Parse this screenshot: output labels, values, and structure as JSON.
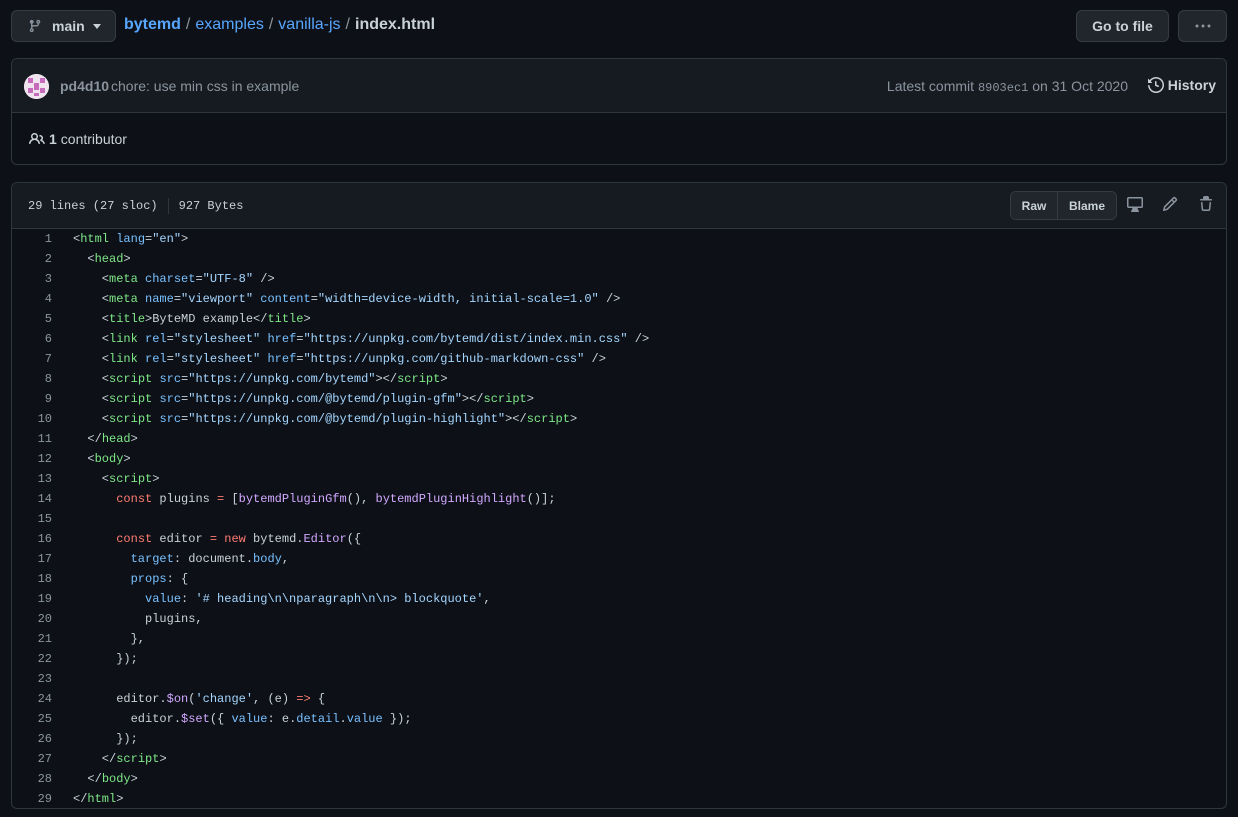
{
  "branch": {
    "name": "main"
  },
  "breadcrumb": {
    "repo": "bytemd",
    "dir1": "examples",
    "dir2": "vanilla-js",
    "file": "index.html",
    "sep": "/"
  },
  "actions": {
    "goto_file": "Go to file"
  },
  "commit": {
    "author": "pd4d10",
    "message": "chore: use min css in example",
    "latest_label": "Latest commit",
    "sha": "8903ec1",
    "date": "on 31 Oct 2020",
    "history": "History"
  },
  "contributors": {
    "count": "1",
    "label": "contributor"
  },
  "file": {
    "lines": "29 lines (27 sloc)",
    "size": "927 Bytes",
    "raw": "Raw",
    "blame": "Blame"
  },
  "colors": {
    "bg": "#0d1117",
    "header_bg": "#161b22",
    "border": "#30363d",
    "link": "#58a6ff",
    "tag": "#7ee787",
    "attr": "#79c0ff",
    "string": "#a5d6ff",
    "keyword": "#ff7b72",
    "function": "#d2a8ff"
  },
  "code_lines": [
    [
      [
        "t",
        "<"
      ],
      [
        "tag",
        "html"
      ],
      [
        "t",
        " "
      ],
      [
        "attr",
        "lang"
      ],
      [
        "t",
        "="
      ],
      [
        "str",
        "\"en\""
      ],
      [
        "t",
        ">"
      ]
    ],
    [
      [
        "t",
        "  <"
      ],
      [
        "tag",
        "head"
      ],
      [
        "t",
        ">"
      ]
    ],
    [
      [
        "t",
        "    <"
      ],
      [
        "tag",
        "meta"
      ],
      [
        "t",
        " "
      ],
      [
        "attr",
        "charset"
      ],
      [
        "t",
        "="
      ],
      [
        "str",
        "\"UTF-8\""
      ],
      [
        "t",
        " />"
      ]
    ],
    [
      [
        "t",
        "    <"
      ],
      [
        "tag",
        "meta"
      ],
      [
        "t",
        " "
      ],
      [
        "attr",
        "name"
      ],
      [
        "t",
        "="
      ],
      [
        "str",
        "\"viewport\""
      ],
      [
        "t",
        " "
      ],
      [
        "attr",
        "content"
      ],
      [
        "t",
        "="
      ],
      [
        "str",
        "\"width=device-width, initial-scale=1.0\""
      ],
      [
        "t",
        " />"
      ]
    ],
    [
      [
        "t",
        "    <"
      ],
      [
        "tag",
        "title"
      ],
      [
        "t",
        ">ByteMD example</"
      ],
      [
        "tag",
        "title"
      ],
      [
        "t",
        ">"
      ]
    ],
    [
      [
        "t",
        "    <"
      ],
      [
        "tag",
        "link"
      ],
      [
        "t",
        " "
      ],
      [
        "attr",
        "rel"
      ],
      [
        "t",
        "="
      ],
      [
        "str",
        "\"stylesheet\""
      ],
      [
        "t",
        " "
      ],
      [
        "attr",
        "href"
      ],
      [
        "t",
        "="
      ],
      [
        "str",
        "\"https://unpkg.com/bytemd/dist/index.min.css\""
      ],
      [
        "t",
        " />"
      ]
    ],
    [
      [
        "t",
        "    <"
      ],
      [
        "tag",
        "link"
      ],
      [
        "t",
        " "
      ],
      [
        "attr",
        "rel"
      ],
      [
        "t",
        "="
      ],
      [
        "str",
        "\"stylesheet\""
      ],
      [
        "t",
        " "
      ],
      [
        "attr",
        "href"
      ],
      [
        "t",
        "="
      ],
      [
        "str",
        "\"https://unpkg.com/github-markdown-css\""
      ],
      [
        "t",
        " />"
      ]
    ],
    [
      [
        "t",
        "    <"
      ],
      [
        "tag",
        "script"
      ],
      [
        "t",
        " "
      ],
      [
        "attr",
        "src"
      ],
      [
        "t",
        "="
      ],
      [
        "str",
        "\"https://unpkg.com/bytemd\""
      ],
      [
        "t",
        "></"
      ],
      [
        "tag",
        "script"
      ],
      [
        "t",
        ">"
      ]
    ],
    [
      [
        "t",
        "    <"
      ],
      [
        "tag",
        "script"
      ],
      [
        "t",
        " "
      ],
      [
        "attr",
        "src"
      ],
      [
        "t",
        "="
      ],
      [
        "str",
        "\"https://unpkg.com/@bytemd/plugin-gfm\""
      ],
      [
        "t",
        "></"
      ],
      [
        "tag",
        "script"
      ],
      [
        "t",
        ">"
      ]
    ],
    [
      [
        "t",
        "    <"
      ],
      [
        "tag",
        "script"
      ],
      [
        "t",
        " "
      ],
      [
        "attr",
        "src"
      ],
      [
        "t",
        "="
      ],
      [
        "str",
        "\"https://unpkg.com/@bytemd/plugin-highlight\""
      ],
      [
        "t",
        "></"
      ],
      [
        "tag",
        "script"
      ],
      [
        "t",
        ">"
      ]
    ],
    [
      [
        "t",
        "  </"
      ],
      [
        "tag",
        "head"
      ],
      [
        "t",
        ">"
      ]
    ],
    [
      [
        "t",
        "  <"
      ],
      [
        "tag",
        "body"
      ],
      [
        "t",
        ">"
      ]
    ],
    [
      [
        "t",
        "    <"
      ],
      [
        "tag",
        "script"
      ],
      [
        "t",
        ">"
      ]
    ],
    [
      [
        "t",
        "      "
      ],
      [
        "kw",
        "const"
      ],
      [
        "t",
        " plugins "
      ],
      [
        "kw",
        "="
      ],
      [
        "t",
        " ["
      ],
      [
        "fn",
        "bytemdPluginGfm"
      ],
      [
        "t",
        "(), "
      ],
      [
        "fn",
        "bytemdPluginHighlight"
      ],
      [
        "t",
        "()];"
      ]
    ],
    [
      [
        "t",
        ""
      ]
    ],
    [
      [
        "t",
        "      "
      ],
      [
        "kw",
        "const"
      ],
      [
        "t",
        " editor "
      ],
      [
        "kw",
        "="
      ],
      [
        "t",
        " "
      ],
      [
        "kw",
        "new"
      ],
      [
        "t",
        " bytemd."
      ],
      [
        "fn",
        "Editor"
      ],
      [
        "t",
        "({"
      ]
    ],
    [
      [
        "t",
        "        "
      ],
      [
        "prop",
        "target"
      ],
      [
        "t",
        ": document."
      ],
      [
        "prop",
        "body"
      ],
      [
        "t",
        ","
      ]
    ],
    [
      [
        "t",
        "        "
      ],
      [
        "prop",
        "props"
      ],
      [
        "t",
        ": {"
      ]
    ],
    [
      [
        "t",
        "          "
      ],
      [
        "prop",
        "value"
      ],
      [
        "t",
        ": "
      ],
      [
        "str",
        "'# heading\\n\\nparagraph\\n\\n> blockquote'"
      ],
      [
        "t",
        ","
      ]
    ],
    [
      [
        "t",
        "          plugins,"
      ]
    ],
    [
      [
        "t",
        "        },"
      ]
    ],
    [
      [
        "t",
        "      });"
      ]
    ],
    [
      [
        "t",
        ""
      ]
    ],
    [
      [
        "t",
        "      editor."
      ],
      [
        "fn",
        "$on"
      ],
      [
        "t",
        "("
      ],
      [
        "str",
        "'change'"
      ],
      [
        "t",
        ", (e) "
      ],
      [
        "kw",
        "=>"
      ],
      [
        "t",
        " {"
      ]
    ],
    [
      [
        "t",
        "        editor."
      ],
      [
        "fn",
        "$set"
      ],
      [
        "t",
        "({ "
      ],
      [
        "prop",
        "value"
      ],
      [
        "t",
        ": e."
      ],
      [
        "prop",
        "detail"
      ],
      [
        "t",
        "."
      ],
      [
        "prop",
        "value"
      ],
      [
        "t",
        " });"
      ]
    ],
    [
      [
        "t",
        "      });"
      ]
    ],
    [
      [
        "t",
        "    </"
      ],
      [
        "tag",
        "script"
      ],
      [
        "t",
        ">"
      ]
    ],
    [
      [
        "t",
        "  </"
      ],
      [
        "tag",
        "body"
      ],
      [
        "t",
        ">"
      ]
    ],
    [
      [
        "t",
        "</"
      ],
      [
        "tag",
        "html"
      ],
      [
        "t",
        ">"
      ]
    ]
  ]
}
